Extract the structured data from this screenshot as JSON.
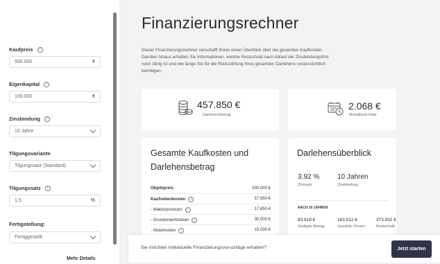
{
  "sidebar": {
    "kaufpreis": {
      "label": "Kaufpreis",
      "value": "500.000",
      "suffix": "€"
    },
    "eigenkapital": {
      "label": "Eigenkapital",
      "value": "100.000",
      "suffix": "€"
    },
    "zinsbindung": {
      "label": "Zinsbindung",
      "value": "10 Jahre"
    },
    "tilgungsvariante": {
      "label": "Tilgungsvariante",
      "value": "Tilgungssatz (Standard)"
    },
    "tilgungssatz": {
      "label": "Tilgungssatz",
      "value": "1,5",
      "suffix": "%"
    },
    "fertigstellung": {
      "label": "Fertigstellung:",
      "value": "Fertiggestellt"
    },
    "more_details": "Mehr Details"
  },
  "main": {
    "title": "Finanzierungsrechner",
    "intro": "Dieser Finanzierungsrechner verschafft Ihnen einen Überblick über die gesamten Kaufkosten. Darüber hinaus erhalten Sie Informationen, welche Restschuld nach Ablauf der Zinsbindungsfrist noch übrig ist und wie lange Sie für die Rückzahlung Ihres gesamten Darlehens voraussichtlich benötigen.",
    "darlehensbetrag": {
      "value": "457.850 €",
      "label": "Darlehensbetrag"
    },
    "rate": {
      "value": "2.068 €",
      "label": "Monatliche Rate"
    },
    "kaufkosten": {
      "title_line1": "Gesamte Kaufkosten und",
      "title_line2": "Darlehensbetrag",
      "rows": [
        {
          "label": "Objektpreis",
          "value": "500.000 €"
        },
        {
          "label": "Kaufnebenkosten",
          "value": "57.850 €"
        },
        {
          "label": "- Maklerprovision",
          "value": "17.850 €"
        },
        {
          "label": "- Grunderwerbsteuer",
          "value": "30.000 €"
        },
        {
          "label": "- Notarkosten",
          "value": "10.000 €"
        }
      ]
    },
    "ueberblick": {
      "title": "Darlehensüberblick",
      "zinssatz": {
        "value": "3,92 %",
        "label": "Zinssatz"
      },
      "zinsbindung": {
        "value": "10 Jahren",
        "label": "Zinsbindung"
      },
      "after_label": "NACH 10 JAHREN",
      "paid": {
        "value": "83.918 €",
        "label": "Getilgter Betrag"
      },
      "interest": {
        "value": "163.012 €",
        "label": "Gezahlte Zinsen"
      },
      "remaining": {
        "value": "373.932 €",
        "label": "Restschuld"
      }
    }
  },
  "bottom_bar": {
    "text": "Sie möchten individuelle Finanzierungsvorschläge erhalten?",
    "button": "Jetzt starten"
  }
}
